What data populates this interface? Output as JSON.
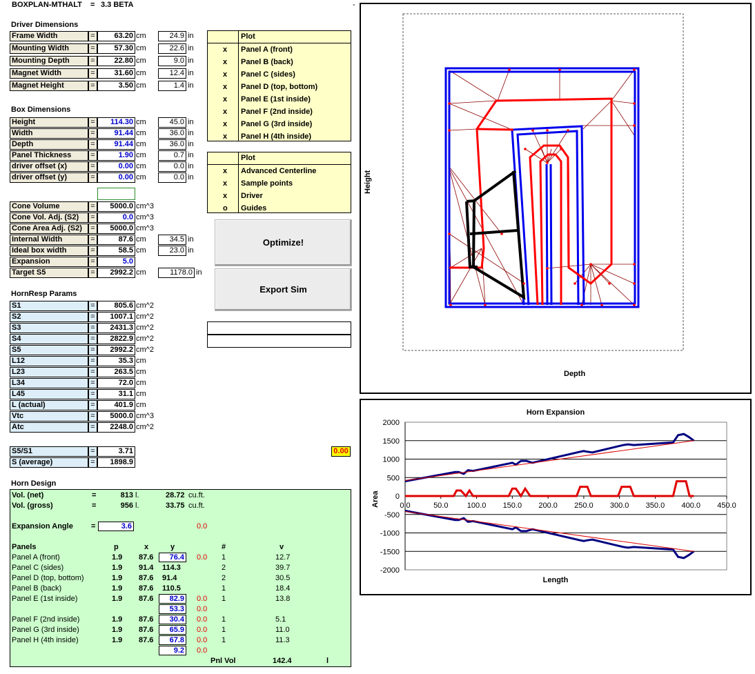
{
  "header": {
    "title": "BOXPLAN-MTHALT",
    "eq": "=",
    "version": "3.3 BETA",
    "dash": "-"
  },
  "driver": {
    "section": "Driver Dimensions",
    "rows": [
      {
        "label": "Frame Width",
        "eq": "=",
        "value": "63.20",
        "unit": "cm",
        "inch": "24.9",
        "iunit": "in"
      },
      {
        "label": "Mounting Width",
        "eq": "=",
        "value": "57.30",
        "unit": "cm",
        "inch": "22.6",
        "iunit": "in"
      },
      {
        "label": "Mounting Depth",
        "eq": "=",
        "value": "22.80",
        "unit": "cm",
        "inch": "9.0",
        "iunit": "in"
      },
      {
        "label": "Magnet Width",
        "eq": "=",
        "value": "31.60",
        "unit": "cm",
        "inch": "12.4",
        "iunit": "in"
      },
      {
        "label": "Magnet Height",
        "eq": "=",
        "value": "3.50",
        "unit": "cm",
        "inch": "1.4",
        "iunit": "in"
      }
    ]
  },
  "box": {
    "section": "Box Dimensions",
    "rows": [
      {
        "label": "Height",
        "eq": "=",
        "value": "114.30",
        "unit": "cm",
        "inch": "45.0",
        "iunit": "in"
      },
      {
        "label": "Width",
        "eq": "=",
        "value": "91.44",
        "unit": "cm",
        "inch": "36.0",
        "iunit": "in"
      },
      {
        "label": "Depth",
        "eq": "=",
        "value": "91.44",
        "unit": "cm",
        "inch": "36.0",
        "iunit": "in"
      },
      {
        "label": "Panel Thickness",
        "eq": "=",
        "value": "1.90",
        "unit": "cm",
        "inch": "0.7",
        "iunit": "in"
      },
      {
        "label": "driver offset (x)",
        "eq": "=",
        "value": "0.00",
        "unit": "cm",
        "inch": "0.0",
        "iunit": "in"
      },
      {
        "label": "driver offset (y)",
        "eq": "=",
        "value": "0.00",
        "unit": "cm",
        "inch": "0.0",
        "iunit": "in"
      }
    ]
  },
  "cone": {
    "rows": [
      {
        "label": "Cone Volume",
        "eq": "=",
        "value": "5000.0",
        "unit": "cm^3"
      },
      {
        "label": "Cone Vol. Adj. (S2)",
        "eq": "=",
        "value": "0.0",
        "unit": "cm^3"
      },
      {
        "label": "Cone Area Adj. (S2)",
        "eq": "=",
        "value": "5000.0",
        "unit": "cm^3"
      },
      {
        "label": "Internal Width",
        "eq": "=",
        "value": "87.6",
        "unit": "cm",
        "inch": "34.5",
        "iunit": "in"
      },
      {
        "label": "Ideal box width",
        "eq": "=",
        "value": "58.5",
        "unit": "cm",
        "inch": "23.0",
        "iunit": "in"
      },
      {
        "label": "Expansion",
        "eq": "=",
        "value": "5.0",
        "unit": ""
      },
      {
        "label": "Target S5",
        "eq": "=",
        "value": "2992.2",
        "unit": "cm",
        "inch": "1178.0",
        "iunit": "in"
      }
    ]
  },
  "hornresp": {
    "section": "HornResp Params",
    "rows": [
      {
        "label": "S1",
        "eq": "=",
        "value": "805.6",
        "unit": "cm^2"
      },
      {
        "label": "S2",
        "eq": "=",
        "value": "1007.1",
        "unit": "cm^2"
      },
      {
        "label": "S3",
        "eq": "=",
        "value": "2431.3",
        "unit": "cm^2"
      },
      {
        "label": "S4",
        "eq": "=",
        "value": "2822.9",
        "unit": "cm^2"
      },
      {
        "label": "S5",
        "eq": "=",
        "value": "2992.2",
        "unit": "cm^2"
      },
      {
        "label": "L12",
        "eq": "=",
        "value": "35.3",
        "unit": "cm"
      },
      {
        "label": "L23",
        "eq": "=",
        "value": "263.5",
        "unit": "cm"
      },
      {
        "label": "L34",
        "eq": "=",
        "value": "72.0",
        "unit": "cm"
      },
      {
        "label": "L45",
        "eq": "=",
        "value": "31.1",
        "unit": "cm"
      },
      {
        "label": "L (actual)",
        "eq": "=",
        "value": "401.9",
        "unit": "cm"
      },
      {
        "label": "Vtc",
        "eq": "=",
        "value": "5000.0",
        "unit": "cm^3"
      },
      {
        "label": "Atc",
        "eq": "=",
        "value": "2248.0",
        "unit": "cm^2"
      }
    ]
  },
  "ratio": {
    "rows": [
      {
        "label": "S5/S1",
        "eq": "=",
        "value": "3.71"
      },
      {
        "label": "S (average)",
        "eq": "=",
        "value": "1898.9"
      }
    ],
    "flag": "0.00"
  },
  "plot1": {
    "header": "Plot",
    "rows": [
      {
        "mark": "x",
        "label": "Panel A (front)"
      },
      {
        "mark": "x",
        "label": "Panel B (back)"
      },
      {
        "mark": "x",
        "label": "Panel C (sides)"
      },
      {
        "mark": "x",
        "label": "Panel D (top, bottom)"
      },
      {
        "mark": "x",
        "label": "Panel E (1st inside)"
      },
      {
        "mark": "x",
        "label": "Panel F (2nd inside)"
      },
      {
        "mark": "x",
        "label": "Panel G (3rd inside)"
      },
      {
        "mark": "x",
        "label": "Panel H (4th inside)"
      }
    ]
  },
  "plot2": {
    "header": "Plot",
    "rows": [
      {
        "mark": "x",
        "label": "Advanced Centerline"
      },
      {
        "mark": "x",
        "label": "Sample points"
      },
      {
        "mark": "x",
        "label": "Driver"
      },
      {
        "mark": "o",
        "label": "Guides"
      }
    ]
  },
  "buttons": {
    "optimize": "Optimize!",
    "export": "Export Sim"
  },
  "horn_design": {
    "section": "Horn Design",
    "vol_net": {
      "label": "Vol. (net)",
      "eq": "=",
      "value": "813",
      "unit": "l.",
      "cuft": "28.72",
      "cuunit": "cu.ft."
    },
    "vol_gross": {
      "label": "Vol. (gross)",
      "eq": "=",
      "value": "956",
      "unit": "l.",
      "cuft": "33.75",
      "cuunit": "cu.ft."
    },
    "exp_angle": {
      "label": "Expansion Angle",
      "eq": "=",
      "value": "3.6",
      "extra": "0.0"
    },
    "cols": {
      "panels": "Panels",
      "p": "p",
      "x": "x",
      "y": "y",
      "n": "#",
      "v": "v"
    },
    "panels": [
      {
        "name": "Panel A (front)",
        "p": "1.9",
        "x": "87.6",
        "y": "76.4",
        "yin": true,
        "r": "0.0",
        "n": "1",
        "v": "12.7"
      },
      {
        "name": "Panel C (sides)",
        "p": "1.9",
        "x": "91.4",
        "y": "114.3",
        "yin": false,
        "r": "",
        "n": "2",
        "v": "39.7"
      },
      {
        "name": "Panel D (top, bottom)",
        "p": "1.9",
        "x": "87.6",
        "y": "91.4",
        "yin": false,
        "r": "",
        "n": "2",
        "v": "30.5"
      },
      {
        "name": "Panel B (back)",
        "p": "1.9",
        "x": "87.6",
        "y": "110.5",
        "yin": false,
        "r": "",
        "n": "1",
        "v": "18.4"
      },
      {
        "name": "Panel E (1st inside)",
        "p": "1.9",
        "x": "87.6",
        "y": "82.9",
        "yin": true,
        "r": "0.0",
        "n": "1",
        "v": "13.8"
      },
      {
        "name": "",
        "p": "",
        "x": "",
        "y": "53.3",
        "yin": true,
        "r": "0.0",
        "n": "",
        "v": ""
      },
      {
        "name": "Panel F (2nd inside)",
        "p": "1.9",
        "x": "87.6",
        "y": "30.4",
        "yin": true,
        "r": "0.0",
        "n": "1",
        "v": "5.1"
      },
      {
        "name": "Panel G (3rd inside)",
        "p": "1.9",
        "x": "87.6",
        "y": "65.9",
        "yin": true,
        "r": "0.0",
        "n": "1",
        "v": "11.0"
      },
      {
        "name": "Panel H (4th inside)",
        "p": "1.9",
        "x": "87.6",
        "y": "67.8",
        "yin": true,
        "r": "0.0",
        "n": "1",
        "v": "11.3"
      },
      {
        "name": "",
        "p": "",
        "x": "",
        "y": "9.2",
        "yin": true,
        "r": "0.0",
        "n": "",
        "v": ""
      }
    ],
    "pnl_vol": {
      "label": "Pnl Vol",
      "value": "142.4",
      "unit": "l"
    }
  },
  "layout_chart": {
    "xlabel": "Depth",
    "ylabel": "Height"
  },
  "chart_data": {
    "type": "line",
    "title": "Horn Expansion",
    "xlabel": "Length",
    "ylabel": "Area",
    "xlim": [
      0,
      450
    ],
    "ylim": [
      -2000,
      2000
    ],
    "xticks": [
      "0.0",
      "50.0",
      "100.0",
      "150.0",
      "200.0",
      "250.0",
      "300.0",
      "350.0",
      "400.0",
      "450.0"
    ],
    "yticks": [
      "2000",
      "1500",
      "1000",
      "500",
      "0",
      "-500",
      "-1000",
      "-1500",
      "-2000"
    ],
    "series": [
      {
        "color": "#000080",
        "x": [
          0,
          70,
          75,
          82,
          88,
          95,
          145,
          150,
          155,
          162,
          170,
          178,
          245,
          250,
          255,
          262,
          305,
          312,
          320,
          375,
          382,
          390,
          397,
          404
        ],
        "y": [
          400,
          650,
          650,
          600,
          700,
          680,
          880,
          900,
          850,
          950,
          950,
          900,
          1200,
          1220,
          1200,
          1180,
          1380,
          1400,
          1380,
          1450,
          1650,
          1680,
          1600,
          1500
        ]
      },
      {
        "color": "#000080",
        "x": [
          0,
          70,
          75,
          82,
          88,
          95,
          145,
          150,
          155,
          162,
          170,
          178,
          245,
          250,
          255,
          262,
          305,
          312,
          320,
          375,
          382,
          390,
          397,
          404
        ],
        "y": [
          -400,
          -650,
          -650,
          -600,
          -700,
          -680,
          -880,
          -900,
          -850,
          -950,
          -950,
          -900,
          -1200,
          -1220,
          -1200,
          -1180,
          -1380,
          -1400,
          -1380,
          -1450,
          -1650,
          -1680,
          -1600,
          -1500
        ]
      },
      {
        "color": "#e00000",
        "x": [
          0,
          68,
          72,
          78,
          85,
          90,
          95,
          145,
          150,
          155,
          162,
          168,
          175,
          240,
          245,
          255,
          260,
          298,
          303,
          315,
          320,
          375,
          380,
          393,
          398,
          404
        ],
        "y": [
          0,
          0,
          150,
          150,
          0,
          150,
          0,
          0,
          200,
          200,
          0,
          200,
          0,
          0,
          250,
          250,
          0,
          0,
          250,
          250,
          0,
          0,
          400,
          400,
          0,
          0
        ]
      },
      {
        "color": "#e00000",
        "x": [
          0,
          404
        ],
        "y": [
          420,
          1500
        ]
      },
      {
        "color": "#e00000",
        "x": [
          0,
          404
        ],
        "y": [
          -420,
          -1500
        ]
      }
    ]
  }
}
